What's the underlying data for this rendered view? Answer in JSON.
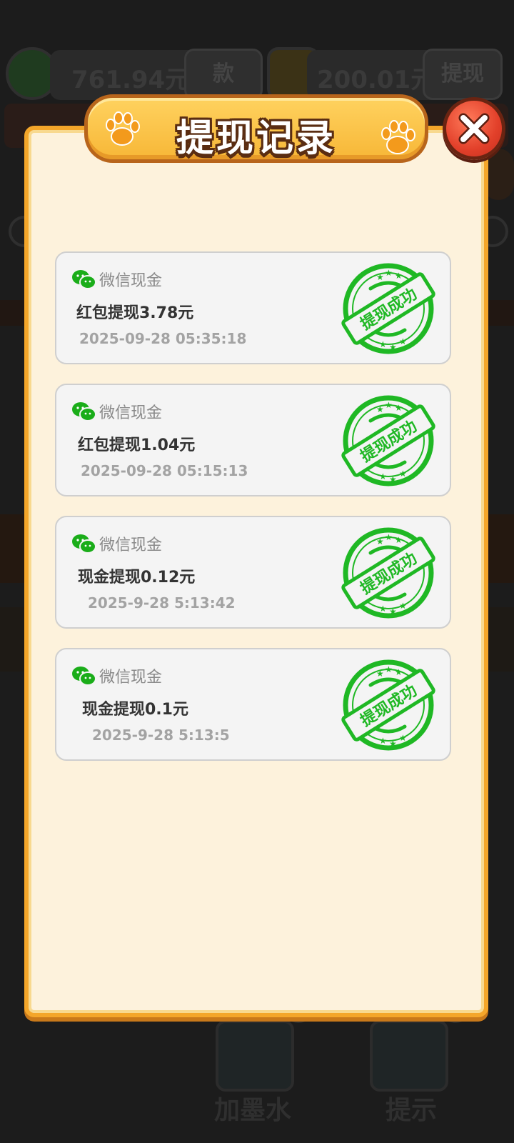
{
  "background": {
    "balance_amount": "761.94元",
    "balance_button_label": "款",
    "cash_amount": "200.01元",
    "cash_button_label": "提现",
    "tools": [
      {
        "label": "加墨水"
      },
      {
        "label": "提示"
      }
    ]
  },
  "dialog": {
    "title": "提现记录",
    "records": [
      {
        "source": "微信现金",
        "title": "红包提现3.78元",
        "time": "2025-09-28 05:35:18",
        "stamp": "提现成功"
      },
      {
        "source": "微信现金",
        "title": "红包提现1.04元",
        "time": "2025-09-28 05:15:13",
        "stamp": "提现成功"
      },
      {
        "source": "微信现金",
        "title": "现金提现0.12元",
        "time": "2025-9-28 5:13:42",
        "stamp": "提现成功"
      },
      {
        "source": "微信现金",
        "title": "现金提现0.1元",
        "time": "2025-9-28 5:13:5",
        "stamp": "提现成功"
      }
    ]
  },
  "colors": {
    "stamp_green": "#1fb824",
    "dialog_border": "#f4a62a",
    "close_red": "#e2402a"
  }
}
